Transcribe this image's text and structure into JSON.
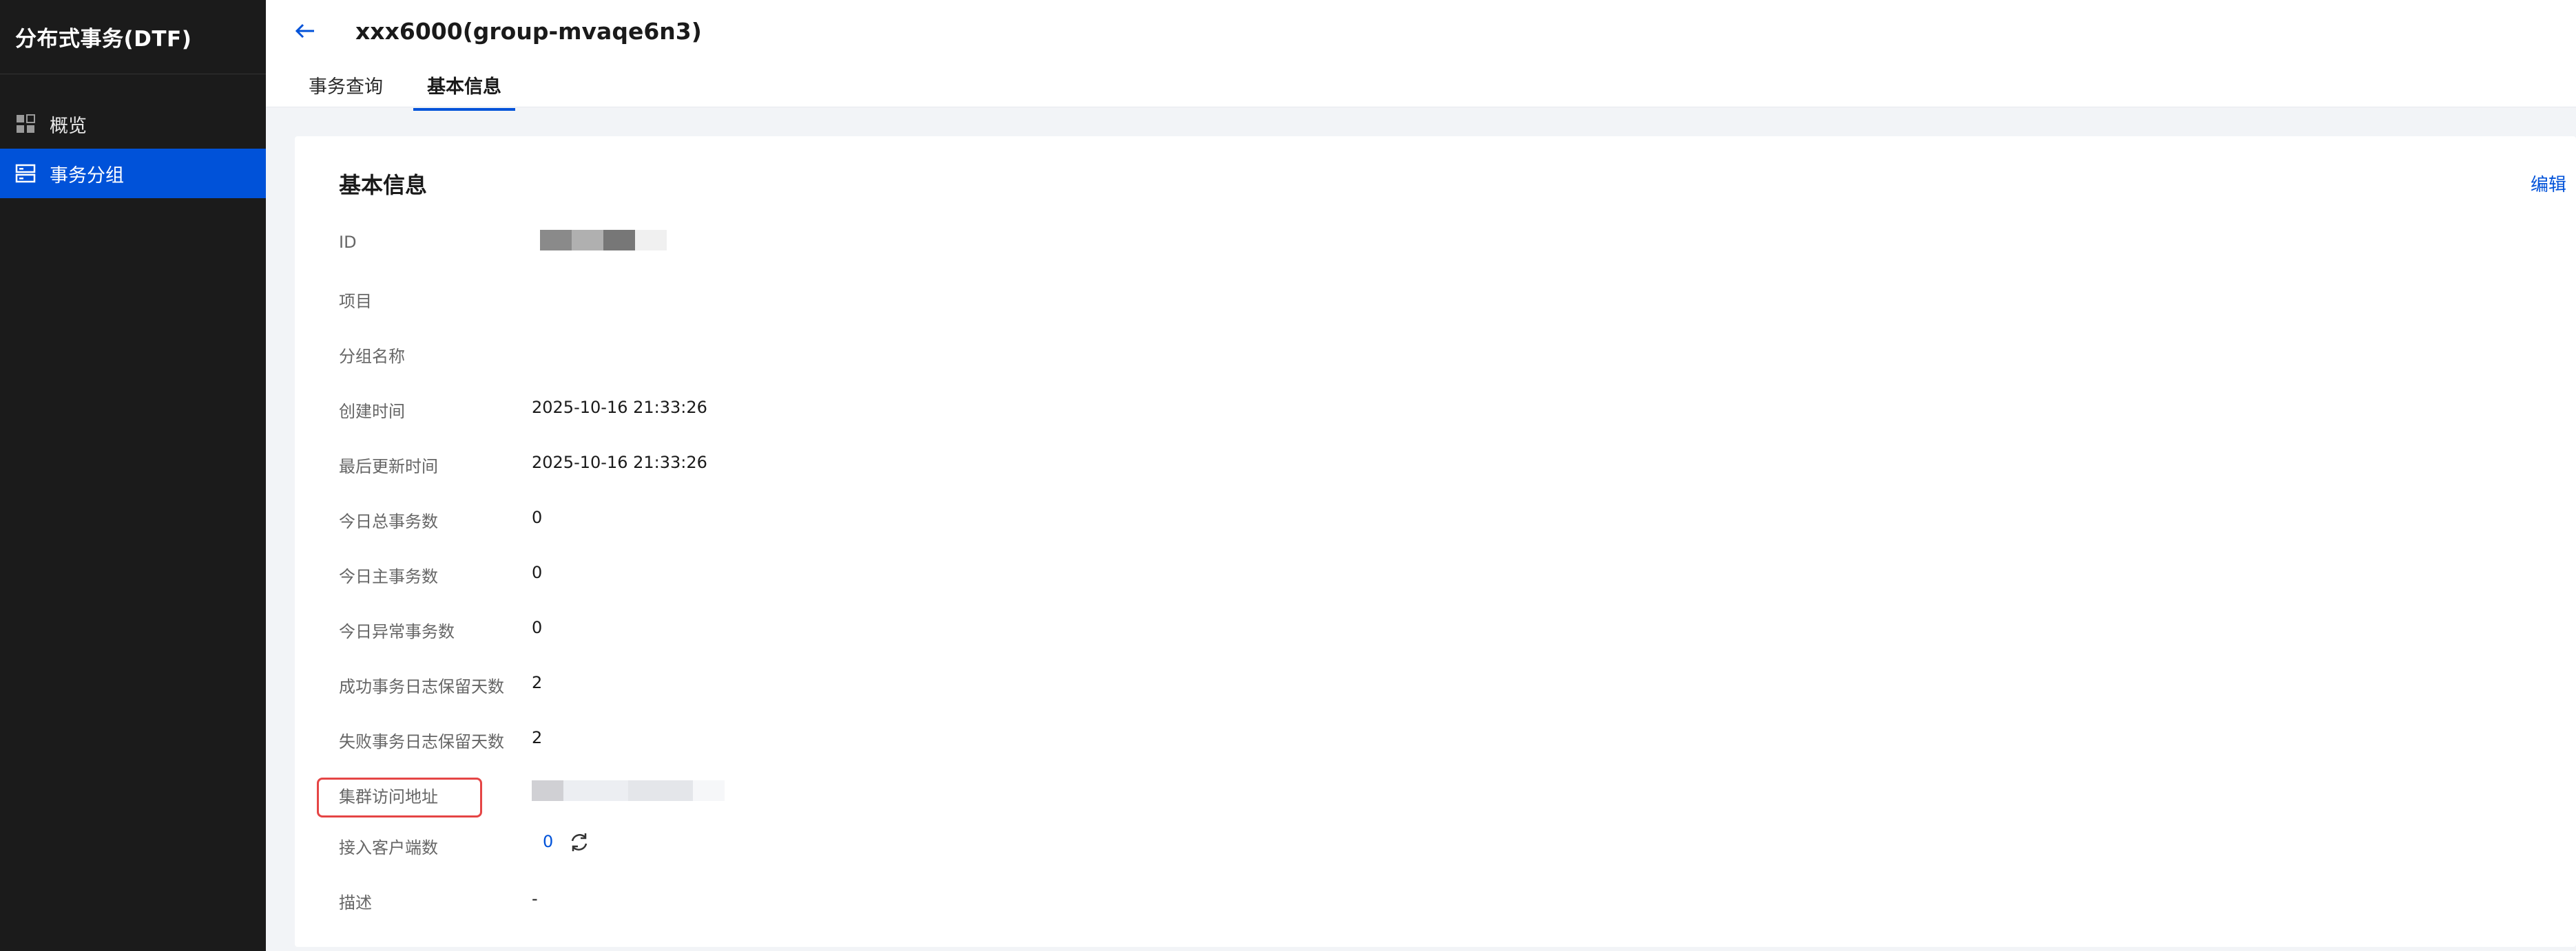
{
  "sidebar": {
    "brand": "分布式事务(DTF)",
    "items": [
      {
        "label": "概览",
        "icon": "grid-icon",
        "active": false
      },
      {
        "label": "事务分组",
        "icon": "list-icon",
        "active": true
      }
    ]
  },
  "header": {
    "title": "xxx6000(group-mvaqe6n3)",
    "tabs": [
      {
        "label": "事务查询",
        "active": false
      },
      {
        "label": "基本信息",
        "active": true
      }
    ]
  },
  "card": {
    "title": "基本信息",
    "edit_label": "编辑",
    "rows": [
      {
        "label": "ID",
        "value": ""
      },
      {
        "label": "项目",
        "value": ""
      },
      {
        "label": "分组名称",
        "value": ""
      },
      {
        "label": "创建时间",
        "value": "2025-10-16 21:33:26"
      },
      {
        "label": "最后更新时间",
        "value": "2025-10-16 21:33:26"
      },
      {
        "label": "今日总事务数",
        "value": "0"
      },
      {
        "label": "今日主事务数",
        "value": "0"
      },
      {
        "label": "今日异常事务数",
        "value": "0"
      },
      {
        "label": "成功事务日志保留天数",
        "value": "2"
      },
      {
        "label": "失败事务日志保留天数",
        "value": "2"
      },
      {
        "label": "集群访问地址",
        "value": ""
      },
      {
        "label": "接入客户端数",
        "value": "0"
      },
      {
        "label": "描述",
        "value": "-"
      }
    ]
  },
  "colors": {
    "accent": "#0052d9",
    "sidebar_bg": "#1b1b1b",
    "highlight": "#e54545"
  }
}
